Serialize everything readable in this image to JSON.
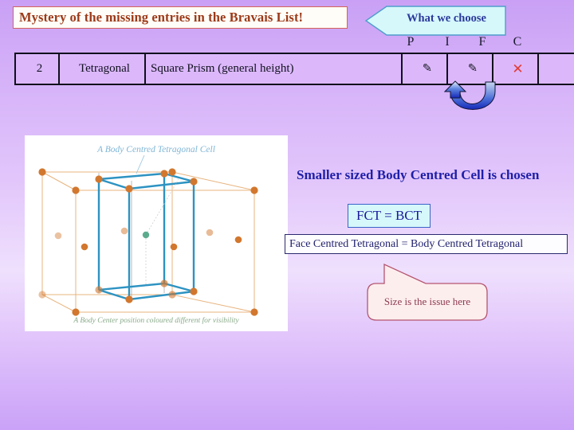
{
  "slide": {
    "title": "Mystery of the missing entries in the Bravais List!"
  },
  "choose_banner": {
    "label": "What we choose",
    "direction": "left-arrow",
    "fill": "#d6f8fb",
    "text_color": "#2b3a9c"
  },
  "lattice_table": {
    "column_headers": [
      "P",
      "I",
      "F",
      "C"
    ],
    "row": {
      "number": "2",
      "system": "Tetragonal",
      "cell_name": "Square Prism (general height)",
      "marks": [
        {
          "column": "P",
          "symbol": "✎",
          "state": "chosen",
          "icon": "flag-check-icon"
        },
        {
          "column": "I",
          "symbol": "✎",
          "state": "chosen",
          "icon": "flag-check-icon"
        },
        {
          "column": "F",
          "symbol": "✕",
          "state": "rejected",
          "icon": "cross-icon"
        },
        {
          "column": "C",
          "symbol": "",
          "state": "empty",
          "icon": ""
        }
      ]
    },
    "cell_background": "#dcb8fb",
    "rejected_background": "#fcdcec",
    "rejected_color": "#e23b32"
  },
  "uturn_arrow": {
    "icon": "u-turn-arrow-icon",
    "color_start": "#8fb4e8",
    "color_end": "#1b3fd0"
  },
  "cell_figure": {
    "caption_top": "A Body Centred Tetragonal Cell",
    "caption_bottom": "A Body Center position coloured different for visibility",
    "caption_top_color": "#7fb6d6",
    "caption_bottom_color": "#8aab8a",
    "bct_edge_color": "#2d93c2",
    "outer_edge_color": "#e0a86a",
    "atom_color": "#d2772e",
    "body_center_color": "#3f9e7a"
  },
  "statements": {
    "smaller_cell": "Smaller sized Body Centred Cell is chosen",
    "equality_short": "FCT = BCT",
    "equality_long": "Face Centred Tetragonal = Body Centred Tetragonal"
  },
  "size_callout": {
    "label": "Size is the issue here",
    "fill": "#fdeeee",
    "border": "#b45570",
    "text_color": "#8c3a50"
  }
}
